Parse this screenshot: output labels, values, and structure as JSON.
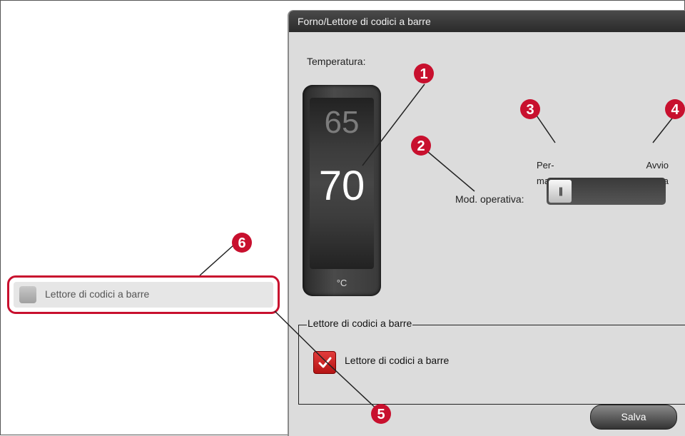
{
  "dialog": {
    "title": "Forno/Lettore di codici a barre",
    "temperature_label": "Temperatura:",
    "temperature_prev": "65",
    "temperature_current": "70",
    "temperature_unit": "°C",
    "mode_label": "Mod. operativa:",
    "mode_option_permanent": "Per-\nmanente",
    "mode_option_program": "Avvio\nprogramma",
    "mode_selected": "Permanente",
    "slider_grip": "|||",
    "group_title": "Lettore di codici a barre",
    "barcode_checkbox_label": "Lettore di codici a barre",
    "barcode_checked": true,
    "save_label": "Salva"
  },
  "callout": {
    "label": "Lettore di codici a barre",
    "checked": false
  },
  "badges": [
    "1",
    "2",
    "3",
    "4",
    "5",
    "6"
  ],
  "colors": {
    "accent": "#c8102e",
    "title_bar": "#2a2a2a",
    "dialog_bg": "#dcdcdc"
  }
}
